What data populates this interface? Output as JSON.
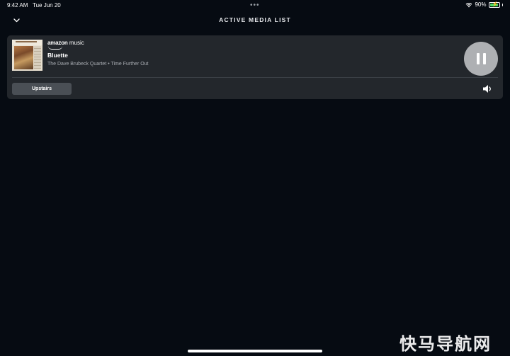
{
  "status_bar": {
    "time": "9:42 AM",
    "date": "Tue Jun 20",
    "dots": "•••",
    "battery_percent": "90%",
    "battery_level": 0.9,
    "icons": [
      "wifi-icon",
      "battery-icon"
    ]
  },
  "header": {
    "title": "ACTIVE MEDIA LIST",
    "collapse_icon": "chevron-down-icon"
  },
  "media_card": {
    "provider": {
      "amazon": "amazon",
      "music": "music"
    },
    "track_title": "Bluette",
    "track_subtitle": "The Dave Brubeck Quartet • Time Further Out",
    "playback_state_icon": "pause-icon",
    "device_label": "Upstairs",
    "volume_icon": "speaker-icon"
  },
  "watermark": "快马导航网",
  "colors": {
    "background": "#060b12",
    "card": "#23272c",
    "pause_button": "#aeb0b3",
    "device_button": "#4a4f55",
    "subtitle_text": "#a9adb3",
    "battery_fill": "#4cd964"
  }
}
